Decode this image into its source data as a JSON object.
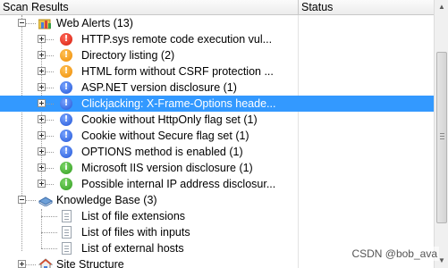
{
  "columns": {
    "scan_results": "Scan Results",
    "status": "Status"
  },
  "tree": {
    "web_alerts": {
      "label": "Web Alerts (13)",
      "items": [
        {
          "label": "HTTP.sys remote code execution vul...",
          "severity": "high",
          "glyph": "!"
        },
        {
          "label": "Directory listing (2)",
          "severity": "medium",
          "glyph": "!"
        },
        {
          "label": "HTML form without CSRF protection ...",
          "severity": "medium",
          "glyph": "!"
        },
        {
          "label": "ASP.NET version disclosure (1)",
          "severity": "low",
          "glyph": "!"
        },
        {
          "label": "Clickjacking: X-Frame-Options heade...",
          "severity": "low",
          "glyph": "!",
          "selected": true
        },
        {
          "label": "Cookie without HttpOnly flag set (1)",
          "severity": "low",
          "glyph": "!"
        },
        {
          "label": "Cookie without Secure flag set (1)",
          "severity": "low",
          "glyph": "!"
        },
        {
          "label": "OPTIONS method is enabled (1)",
          "severity": "low",
          "glyph": "!"
        },
        {
          "label": "Microsoft IIS version disclosure (1)",
          "severity": "info",
          "glyph": "i"
        },
        {
          "label": "Possible internal IP address disclosur...",
          "severity": "info",
          "glyph": "i"
        }
      ]
    },
    "knowledge_base": {
      "label": "Knowledge Base (3)",
      "items": [
        {
          "label": "List of file extensions"
        },
        {
          "label": "List of files with inputs"
        },
        {
          "label": "List of external hosts"
        }
      ]
    },
    "site_structure": {
      "label": "Site Structure"
    }
  },
  "watermark": "CSDN @bob_ava",
  "colors": {
    "selection": "#3399ff",
    "high": "#d61b0b",
    "medium": "#ee8a00",
    "low": "#2155d6",
    "info": "#2f9a1c"
  }
}
